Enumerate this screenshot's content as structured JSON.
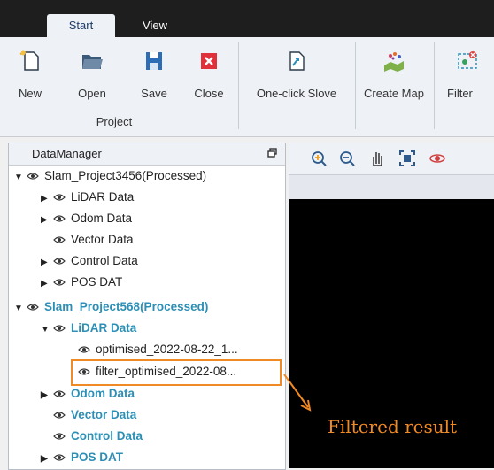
{
  "tabs": {
    "start": "Start",
    "view": "View"
  },
  "ribbon": {
    "buttons": [
      {
        "label": "New",
        "icon": "new-file-icon"
      },
      {
        "label": "Open",
        "icon": "folder-open-icon"
      },
      {
        "label": "Save",
        "icon": "save-icon"
      },
      {
        "label": "Close",
        "icon": "close-icon"
      },
      {
        "label": "One-click Slove",
        "icon": "one-click-solve-icon"
      },
      {
        "label": "Create Map",
        "icon": "create-map-icon"
      },
      {
        "label": "Filter",
        "icon": "filter-icon"
      }
    ],
    "group_label": "Project"
  },
  "data_manager": {
    "title": "DataManager",
    "tree": [
      {
        "label": "Slam_Project3456(Processed)",
        "arrow": "▼"
      },
      {
        "label": "LiDAR Data",
        "arrow": "▶"
      },
      {
        "label": "Odom Data",
        "arrow": "▶"
      },
      {
        "label": "Vector Data",
        "arrow": ""
      },
      {
        "label": "Control Data",
        "arrow": "▶"
      },
      {
        "label": "POS DAT",
        "arrow": "▶"
      },
      {
        "label": "Slam_Project568(Processed)",
        "arrow": "▼"
      },
      {
        "label": "LiDAR Data",
        "arrow": "▼"
      },
      {
        "label": "optimised_2022-08-22_1...",
        "arrow": ""
      },
      {
        "label": "filter_optimised_2022-08...",
        "arrow": ""
      },
      {
        "label": "Odom Data",
        "arrow": "▶"
      },
      {
        "label": "Vector Data",
        "arrow": ""
      },
      {
        "label": "Control Data",
        "arrow": ""
      },
      {
        "label": "POS DAT",
        "arrow": "▶"
      }
    ]
  },
  "viewer": {
    "tools": [
      "zoom-in-icon",
      "zoom-out-icon",
      "pan-hand-icon",
      "fit-view-icon",
      "rotate-view-icon"
    ]
  },
  "annotation": {
    "text": "Filtered result",
    "color": "#f08a24"
  },
  "colors": {
    "accent": "#2d8fb5",
    "highlight": "#f08a24"
  }
}
